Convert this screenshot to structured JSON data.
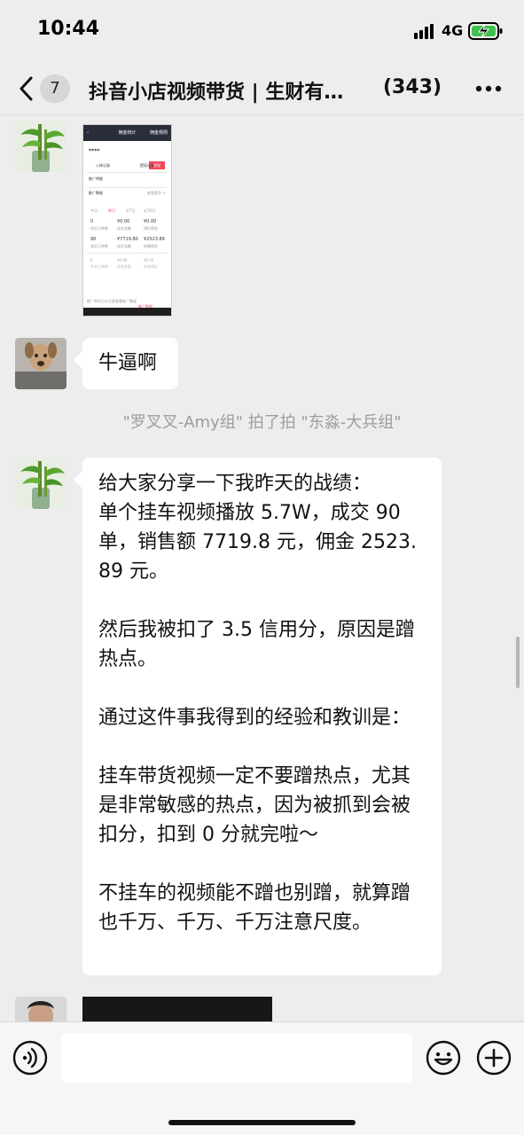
{
  "status_bar": {
    "time": "10:44",
    "network": "4G",
    "icons": [
      "signal-icon",
      "battery-charging-icon"
    ]
  },
  "nav": {
    "back_icon": "chevron-left-icon",
    "unread": "7",
    "title": "抖音小店视频带货 | 生财有…",
    "member_count": "(343)",
    "more_icon": "more-dots-icon"
  },
  "messages": {
    "image_message": {
      "header_title": "佣金统计",
      "header_right": "佣金规则",
      "masked_value": "****",
      "button": "提现",
      "entry_left": "入帐记录",
      "entry_right": "提现记录",
      "section_1": "推广明细",
      "section_2": "推广数据",
      "section_2_right": "查看更多 >",
      "tabs": [
        "今日",
        "昨日",
        "近7日",
        "近30日"
      ],
      "row1": [
        "0",
        "¥0.00",
        "¥0.00"
      ],
      "row1_labels": [
        "成交订单数",
        "成交金额",
        "预估佣金"
      ],
      "row2": [
        "90",
        "¥7719.80",
        "¥2523.89"
      ],
      "row2_labels": [
        "成交订单数",
        "成交金额",
        "结算佣金"
      ],
      "row3": [
        "0",
        "¥0.00",
        "¥0.00"
      ],
      "row3_labels": [
        "失效订单数",
        "失效金额",
        "失效佣金"
      ],
      "footer_text": "推广带货点击立即查看推广数据",
      "footer_link": "推广数据"
    },
    "short_message": {
      "text": "牛逼啊"
    },
    "system_notice": "\"罗叉叉-Amy组\" 拍了拍 \"东淼-大兵组\"",
    "long_message": {
      "text": "给大家分享一下我昨天的战绩：\n单个挂车视频播放 5.7W，成交 90 单，销售额 7719.8 元，佣金 2523.89 元。\n\n然后我被扣了 3.5 信用分，原因是蹭热点。\n\n通过这件事我得到的经验和教训是：\n\n挂车带货视频一定不要蹭热点，尤其是非常敏感的热点，因为被抓到会被扣分，扣到 0 分就完啦～\n\n不挂车的视频能不蹭也别蹭，就算蹭也千万、千万、千万注意尺度。"
    }
  },
  "input_bar": {
    "placeholder": "",
    "icons": [
      "voice-icon",
      "emoji-icon",
      "plus-icon"
    ]
  }
}
